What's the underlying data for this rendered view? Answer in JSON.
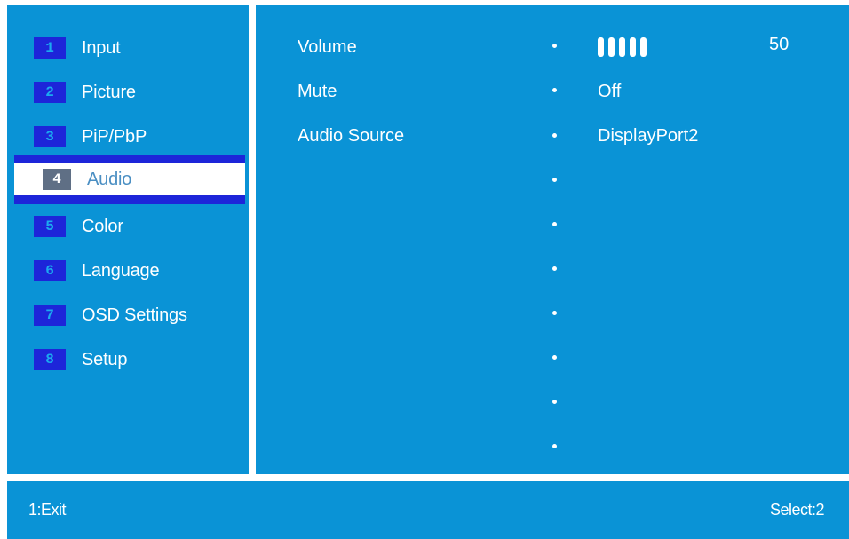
{
  "colors": {
    "panel": "#0a93d6",
    "highlight": "#1d25d9",
    "selected_bg": "#ffffff",
    "text": "#ffffff"
  },
  "menu": {
    "selected_index": 3,
    "items": [
      {
        "num": "1",
        "label": "Input"
      },
      {
        "num": "2",
        "label": "Picture"
      },
      {
        "num": "3",
        "label": "PiP/PbP"
      },
      {
        "num": "4",
        "label": "Audio"
      },
      {
        "num": "5",
        "label": "Color"
      },
      {
        "num": "6",
        "label": "Language"
      },
      {
        "num": "7",
        "label": "OSD Settings"
      },
      {
        "num": "8",
        "label": "Setup"
      }
    ]
  },
  "settings": {
    "volume": {
      "label": "Volume",
      "value": "50",
      "level_ticks": 5
    },
    "mute": {
      "label": "Mute",
      "value": "Off"
    },
    "audio_source": {
      "label": "Audio Source",
      "value": "DisplayPort2"
    }
  },
  "footer": {
    "exit_label": "1:Exit",
    "select_label": "Select:2"
  }
}
